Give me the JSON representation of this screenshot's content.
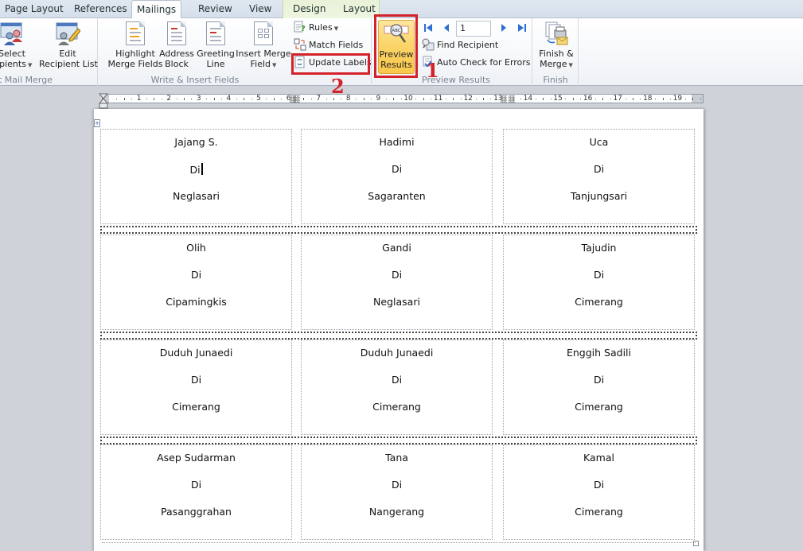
{
  "tabs": [
    {
      "label": "Page Layout",
      "active": false
    },
    {
      "label": "References",
      "active": false
    },
    {
      "label": "Mailings",
      "active": true
    },
    {
      "label": "Review",
      "active": false
    },
    {
      "label": "View",
      "active": false
    },
    {
      "label": "Design",
      "active": false,
      "contextual": true
    },
    {
      "label": "Layout",
      "active": false,
      "contextual": true
    }
  ],
  "ribbon": {
    "start_mail_merge": {
      "label": "t Mail Merge",
      "select_recipients": {
        "line1": "Select",
        "line2": "cipients",
        "icon": "people-list-icon"
      },
      "edit_recipient_list": {
        "line1": "Edit",
        "line2": "Recipient List",
        "icon": "edit-list-icon"
      }
    },
    "write_insert_fields": {
      "label": "Write & Insert Fields",
      "highlight": {
        "line1": "Highlight",
        "line2": "Merge Fields"
      },
      "address_block": {
        "line1": "Address",
        "line2": "Block"
      },
      "greeting_line": {
        "line1": "Greeting",
        "line2": "Line"
      },
      "insert_merge_field": {
        "line1": "Insert Merge",
        "line2": "Field"
      },
      "rules": "Rules",
      "match_fields": "Match Fields",
      "update_labels": "Update Labels"
    },
    "preview_results": {
      "label": "Preview Results",
      "preview_button": {
        "line1": "Preview",
        "line2": "Results",
        "icon": "abc-magnifier-icon"
      },
      "record_number": "1",
      "find_recipient": "Find Recipient",
      "auto_check": "Auto Check for Errors"
    },
    "finish": {
      "label": "Finish",
      "finish_merge": {
        "line1": "Finish &",
        "line2": "Merge"
      }
    }
  },
  "annotations": {
    "step1": "1",
    "step2": "2",
    "highlight_color": "#d3222a"
  },
  "ruler": {
    "numbers": [
      "1",
      "2",
      "3",
      "4",
      "5",
      "6",
      "7",
      "8",
      "9",
      "10",
      "11",
      "12",
      "13",
      "14",
      "15",
      "16",
      "17",
      "18",
      "19"
    ]
  },
  "labels": [
    [
      {
        "name": "Jajang S.",
        "di": "Di",
        "place": "Neglasari"
      },
      {
        "name": "Hadimi",
        "di": "Di",
        "place": "Sagaranten"
      },
      {
        "name": "Uca",
        "di": "Di",
        "place": "Tanjungsari"
      }
    ],
    [
      {
        "name": "Olih",
        "di": "Di",
        "place": "Cipamingkis"
      },
      {
        "name": "Gandi",
        "di": "Di",
        "place": "Neglasari"
      },
      {
        "name": "Tajudin",
        "di": "Di",
        "place": "Cimerang"
      }
    ],
    [
      {
        "name": "Duduh Junaedi",
        "di": "Di",
        "place": "Cimerang"
      },
      {
        "name": "Duduh Junaedi",
        "di": "Di",
        "place": "Cimerang"
      },
      {
        "name": "Enggih Sadili",
        "di": "Di",
        "place": "Cimerang"
      }
    ],
    [
      {
        "name": "Asep Sudarman",
        "di": "Di",
        "place": "Pasanggrahan"
      },
      {
        "name": "Tana",
        "di": "Di",
        "place": "Nangerang"
      },
      {
        "name": "Kamal",
        "di": "Di",
        "place": "Cimerang"
      }
    ]
  ],
  "colors": {
    "preview_active_bg": "#fbd56a",
    "ribbon_bg": "#f4f6f9",
    "workspace_bg": "#cfd3d9",
    "contextual_tab_bg": "#e9f2d8"
  }
}
